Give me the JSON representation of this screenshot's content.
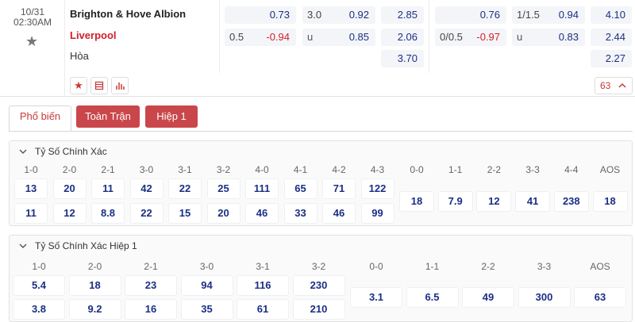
{
  "match": {
    "date": "10/31",
    "time": "02:30AM",
    "home": "Brighton & Hove Albion",
    "away": "Liverpool",
    "draw": "Hòa",
    "more_count": "63"
  },
  "ft_odds": {
    "hdp_home": {
      "line": "",
      "value": "0.73"
    },
    "hdp_away": {
      "line": "0.5",
      "value": "-0.94"
    },
    "ou_over": {
      "line": "3.0",
      "value": "0.92"
    },
    "ou_under": {
      "line": "u",
      "value": "0.85"
    },
    "x12": [
      "2.85",
      "2.06",
      "3.70"
    ]
  },
  "h1_odds": {
    "hdp_home": {
      "line": "",
      "value": "0.76"
    },
    "hdp_away": {
      "line": "0/0.5",
      "value": "-0.97"
    },
    "ou_over": {
      "line": "1/1.5",
      "value": "0.94"
    },
    "ou_under": {
      "line": "u",
      "value": "0.83"
    },
    "x12": [
      "4.10",
      "2.44",
      "2.27"
    ]
  },
  "tabs": [
    "Phổ biến",
    "Toàn Trận",
    "Hiệp 1"
  ],
  "correct_score": {
    "title": "Tỷ Số Chính Xác",
    "home_headers": [
      "1-0",
      "2-0",
      "2-1",
      "3-0",
      "3-1",
      "3-2",
      "4-0",
      "4-1",
      "4-2",
      "4-3"
    ],
    "home_row1": [
      "13",
      "20",
      "11",
      "42",
      "22",
      "25",
      "111",
      "65",
      "71",
      "122"
    ],
    "home_row2": [
      "11",
      "12",
      "8.8",
      "22",
      "15",
      "20",
      "46",
      "33",
      "46",
      "99"
    ],
    "draw_headers": [
      "0-0",
      "1-1",
      "2-2",
      "3-3",
      "4-4",
      "AOS"
    ],
    "draw_values": [
      "18",
      "7.9",
      "12",
      "41",
      "238",
      "18"
    ]
  },
  "correct_score_h1": {
    "title": "Tỷ Số Chính Xác Hiệp 1",
    "home_headers": [
      "1-0",
      "2-0",
      "2-1",
      "3-0",
      "3-1",
      "3-2"
    ],
    "home_row1": [
      "5.4",
      "18",
      "23",
      "94",
      "116",
      "230"
    ],
    "home_row2": [
      "3.8",
      "9.2",
      "16",
      "35",
      "61",
      "210"
    ],
    "draw_headers": [
      "0-0",
      "1-1",
      "2-2",
      "3-3",
      "AOS"
    ],
    "draw_values": [
      "3.1",
      "6.5",
      "49",
      "300",
      "63"
    ]
  }
}
